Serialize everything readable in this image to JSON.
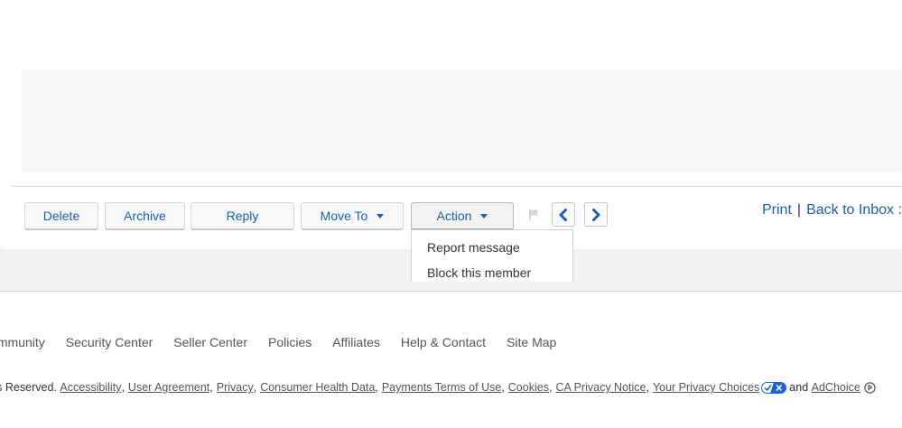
{
  "toolbar": {
    "delete_label": "Delete",
    "archive_label": "Archive",
    "reply_label": "Reply",
    "move_to_label": "Move To",
    "action_label": "Action",
    "flag_icon": "flag-icon",
    "prev_icon": "chevron-left-icon",
    "next_icon": "chevron-right-icon"
  },
  "top_links": {
    "print": "Print",
    "separator": "|",
    "back_to_inbox": "Back to Inbox :"
  },
  "action_menu": {
    "items": [
      "Report message",
      "Block this member"
    ]
  },
  "footer": {
    "nav": [
      "Community",
      "Security Center",
      "Seller Center",
      "Policies",
      "Affiliates",
      "Help & Contact",
      "Site Map"
    ],
    "rights_text": "Rights Reserved.",
    "legal_links": [
      "Accessibility",
      "User Agreement",
      "Privacy",
      "Consumer Health Data",
      "Payments Terms of Use",
      "Cookies",
      "CA Privacy Notice",
      "Your Privacy Choices"
    ],
    "and_text": "and",
    "adchoice_label": "AdChoice"
  },
  "colors": {
    "link_blue": "#1a5fb4",
    "panel_grey": "#f7f7f7",
    "band_grey": "#f2f2f2",
    "privacy_badge_blue": "#1d63d8"
  }
}
